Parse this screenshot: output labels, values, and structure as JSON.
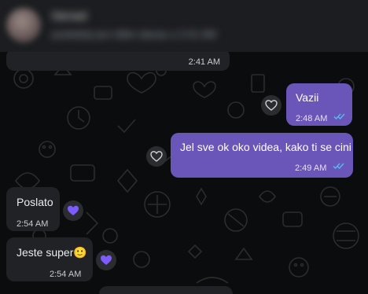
{
  "header": {
    "contact_name": "Nenad",
    "contact_status": "poslednji put viđen danas u 2:41 AM"
  },
  "messages": [
    {
      "id": "m0",
      "direction": "incoming",
      "text": "",
      "time": "2:41 AM"
    },
    {
      "id": "m1",
      "direction": "outgoing",
      "text": "Vazii",
      "time": "2:48 AM",
      "status": "read",
      "reaction": "heart-outline"
    },
    {
      "id": "m2",
      "direction": "outgoing",
      "text": "Jel sve ok oko videa, kako ti se cini",
      "time": "2:49 AM",
      "status": "read",
      "reaction": "heart-outline"
    },
    {
      "id": "m3",
      "direction": "incoming",
      "text": "Poslato",
      "time": "2:54 AM",
      "reaction": "purple-heart"
    },
    {
      "id": "m4",
      "direction": "incoming",
      "text": "Jeste super",
      "emoji": "🙂",
      "time": "2:54 AM",
      "reaction": "purple-heart"
    }
  ],
  "colors": {
    "outgoing_bubble": "#6a55b8",
    "incoming_bubble": "#202225",
    "read_ticks": "#53bdeb",
    "reaction_heart": "#7c5cff"
  }
}
